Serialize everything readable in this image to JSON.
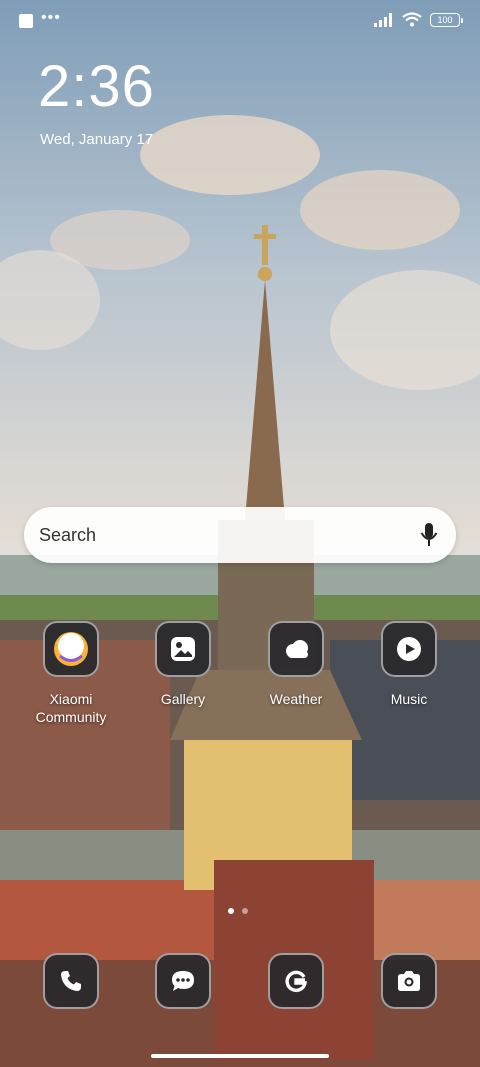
{
  "status_bar": {
    "battery": "100",
    "icons": [
      "notification-square-icon",
      "more-icon",
      "signal-icon",
      "wifi-icon",
      "battery-icon"
    ]
  },
  "lockscreen": {
    "time": "2:36",
    "date": "Wed, January 17"
  },
  "search": {
    "placeholder": "Search"
  },
  "apps": [
    {
      "label": "Xiaomi Community",
      "icon": "xiaomi-community-icon"
    },
    {
      "label": "Gallery",
      "icon": "gallery-icon"
    },
    {
      "label": "Weather",
      "icon": "weather-icon"
    },
    {
      "label": "Music",
      "icon": "music-icon"
    }
  ],
  "dock": [
    {
      "icon": "phone-icon"
    },
    {
      "icon": "messages-icon"
    },
    {
      "icon": "google-icon"
    },
    {
      "icon": "camera-icon"
    }
  ],
  "pager": {
    "pages": 2,
    "current": 1
  }
}
